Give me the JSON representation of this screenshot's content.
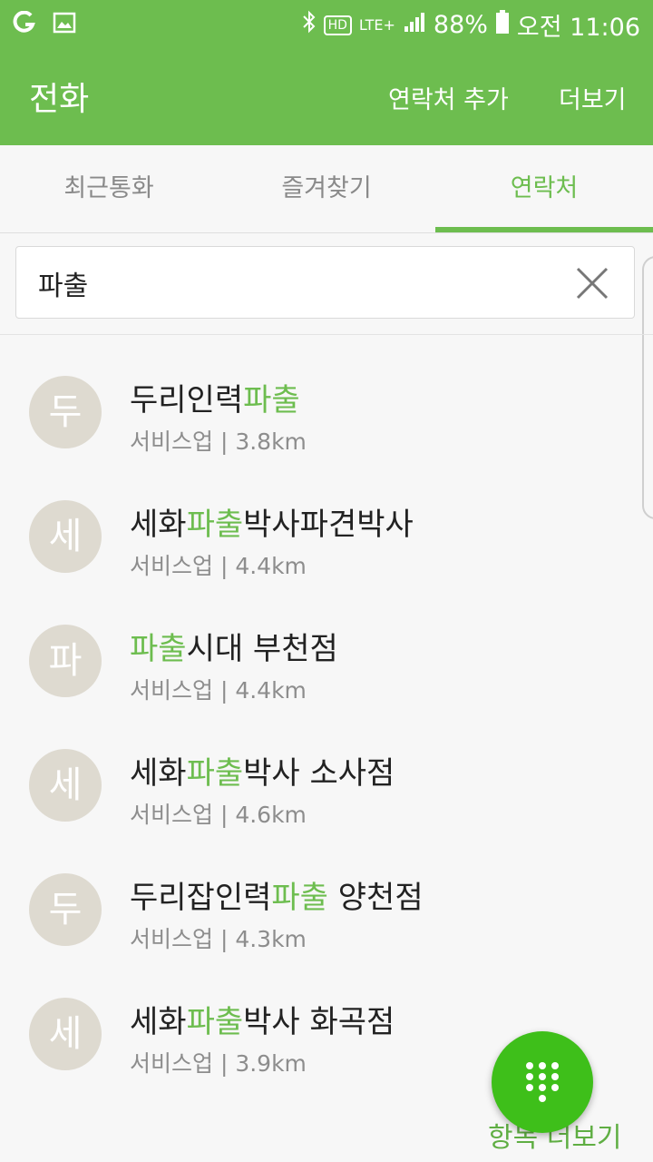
{
  "status": {
    "battery": "88%",
    "time": "오전 11:06",
    "network": "LTE+",
    "hd": "HD"
  },
  "appbar": {
    "title": "전화",
    "add_contact": "연락처 추가",
    "more": "더보기"
  },
  "tabs": [
    {
      "label": "최근통화"
    },
    {
      "label": "즐겨찾기"
    },
    {
      "label": "연락처"
    }
  ],
  "search": {
    "value": "파출"
  },
  "results": [
    {
      "initial": "두",
      "pre": "두리인력",
      "hl": "파출",
      "post": "",
      "category": "서비스업 | 3.8km"
    },
    {
      "initial": "세",
      "pre": "세화",
      "hl": "파출",
      "post": "박사파견박사",
      "category": "서비스업 | 4.4km"
    },
    {
      "initial": "파",
      "pre": "",
      "hl": "파출",
      "post": "시대 부천점",
      "category": "서비스업 | 4.4km"
    },
    {
      "initial": "세",
      "pre": "세화",
      "hl": "파출",
      "post": "박사 소사점",
      "category": "서비스업 | 4.6km"
    },
    {
      "initial": "두",
      "pre": "두리잡인력",
      "hl": "파출",
      "post": " 양천점",
      "category": "서비스업 | 4.3km"
    },
    {
      "initial": "세",
      "pre": "세화",
      "hl": "파출",
      "post": "박사 화곡점",
      "category": "서비스업 | 3.9km"
    }
  ],
  "more_items_label": "항목 더보기",
  "colors": {
    "accent": "#6dbd4f",
    "fab": "#3ebf1a",
    "avatar": "#dedad0"
  }
}
